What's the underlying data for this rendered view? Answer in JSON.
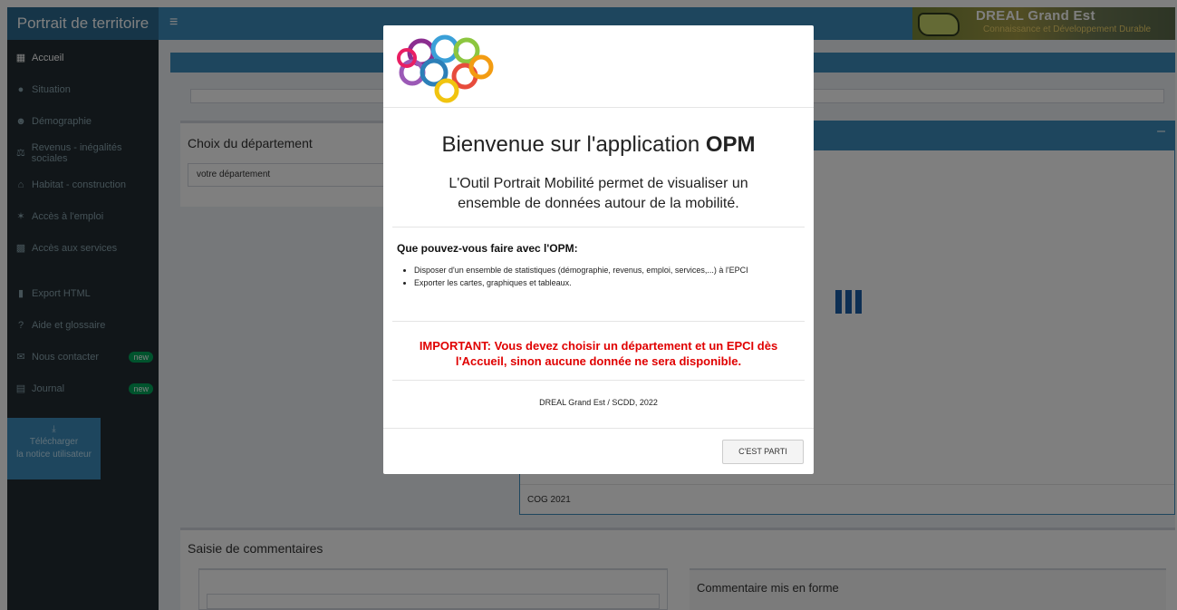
{
  "app": {
    "title": "Portrait de territoire",
    "burger_icon": "≡",
    "brand": {
      "title": "DREAL Grand Est",
      "subtitle": "Connaissance et Développement Durable"
    }
  },
  "sidebar": {
    "items": [
      {
        "label": "Accueil",
        "icon": "map-icon",
        "active": true
      },
      {
        "label": "Situation",
        "icon": "map-marker-icon"
      },
      {
        "label": "Démographie",
        "icon": "users-icon"
      },
      {
        "label": "Revenus - inégalités sociales",
        "icon": "balance-scale-icon"
      },
      {
        "label": "Habitat - construction",
        "icon": "home-icon"
      },
      {
        "label": "Accès à l'emploi",
        "icon": "walking-icon"
      },
      {
        "label": "Accès aux services",
        "icon": "bus-icon"
      },
      {
        "label": "Export HTML",
        "icon": "file-export-icon"
      },
      {
        "label": "Aide et glossaire",
        "icon": "question-circle-icon"
      },
      {
        "label": "Nous contacter",
        "icon": "envelope-icon",
        "badge": "new"
      },
      {
        "label": "Journal",
        "icon": "newspaper-icon",
        "badge": "new"
      }
    ],
    "download": {
      "line1": "Télécharger",
      "line2": "la notice utilisateur"
    }
  },
  "main": {
    "choix_title": "Choix du département",
    "choix_select": "votre département",
    "cog_label": "COG 2021",
    "comment_title": "Saisie de commentaires",
    "comment_right_title": "Commentaire mis en forme"
  },
  "modal": {
    "title_prefix": "Bienvenue sur l'application ",
    "title_bold": "OPM",
    "subtitle": "L'Outil Portrait Mobilité permet de visualiser un ensemble de données autour de la mobilité.",
    "question": "Que pouvez-vous faire avec l'OPM:",
    "bullets": [
      "Disposer d'un ensemble de statistiques (démographie, revenus, emploi, services,...) à l'EPCI",
      "Exporter les cartes, graphiques et tableaux."
    ],
    "important": "IMPORTANT: Vous devez choisir un département et un EPCI dès l'Accueil, sinon aucune donnée ne sera disponible.",
    "footer": "DREAL Grand Est / SCDD, 2022",
    "button": "C'EST PARTI"
  },
  "colors": {
    "primary": "#3c8dbc",
    "sidebar": "#222d32",
    "important": "#e00000",
    "badge": "#00a65a"
  }
}
